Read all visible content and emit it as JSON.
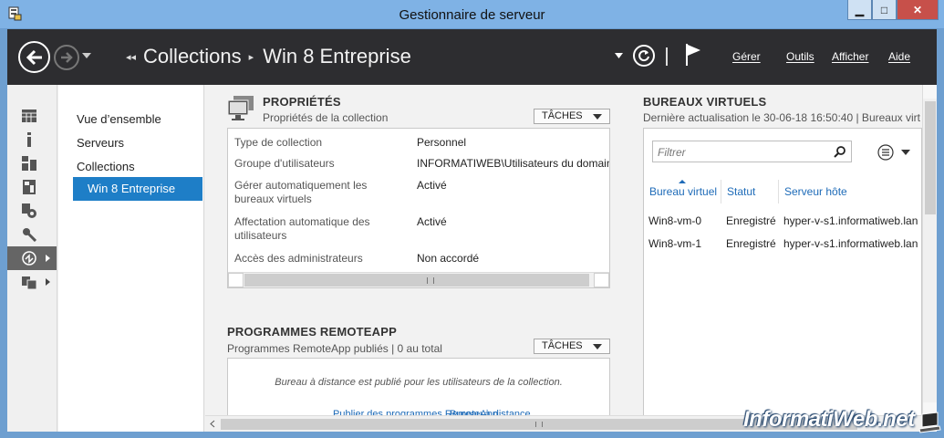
{
  "window": {
    "title": "Gestionnaire de serveur",
    "controls": {
      "minimize": "▁",
      "maximize": "□",
      "close": "✕"
    }
  },
  "header": {
    "breadcrumb": [
      "Collections",
      "Win 8 Entreprise"
    ],
    "menus": [
      "Gérer",
      "Outils",
      "Afficher",
      "Aide"
    ]
  },
  "left_nav": {
    "icons": [
      "dashboard-icon",
      "local-server-icon",
      "all-servers-icon",
      "file-storage-icon",
      "hyper-v-icon",
      "iis-icon",
      "remote-desktop-icon",
      "wsus-icon"
    ],
    "selected": "remote-desktop-icon"
  },
  "sub_nav": {
    "items": [
      "Vue d’ensemble",
      "Serveurs",
      "Collections"
    ],
    "selected": "Win 8 Entreprise"
  },
  "properties": {
    "title": "PROPRIÉTÉS",
    "subtitle": "Propriétés de la collection",
    "tasks_label": "TÂCHES",
    "rows": [
      {
        "label": "Type de collection",
        "value": "Personnel"
      },
      {
        "label": "Groupe d'utilisateurs",
        "value": "INFORMATIWEB\\Utilisateurs du domain"
      },
      {
        "label": "Gérer automatiquement les bureaux virtuels",
        "value": "Activé"
      },
      {
        "label": "Affectation automatique des utilisateurs",
        "value": "Activé"
      },
      {
        "label": "Accès des administrateurs",
        "value": "Non accordé"
      }
    ]
  },
  "remoteapp": {
    "title": "PROGRAMMES REMOTEAPP",
    "subtitle": "Programmes RemoteApp publiés | 0 au total",
    "tasks_label": "TÂCHES",
    "message": "Bureau à distance est publié pour les utilisateurs de la collection.",
    "links": [
      "Publier des programmes RemoteApp",
      "Bureau à distance"
    ]
  },
  "virtual_desktops": {
    "title": "BUREAUX VIRTUELS",
    "subtitle": "Dernière actualisation le 30-06-18 16:50:40 | Bureaux virt",
    "filter_placeholder": "Filtrer",
    "columns": [
      "Bureau virtuel",
      "Statut",
      "Serveur hôte"
    ],
    "rows": [
      [
        "Win8-vm-0",
        "Enregistré",
        "hyper-v-s1.informatiweb.lan"
      ],
      [
        "Win8-vm-1",
        "Enregistré",
        "hyper-v-s1.informatiweb.lan"
      ]
    ]
  },
  "watermark": "InformatiWeb.net",
  "colors": {
    "header_bg": "#2d2d30",
    "titlebar_bg": "#7fb2e5",
    "selected_nav": "#1e7ec7",
    "link": "#1e6bb8"
  }
}
